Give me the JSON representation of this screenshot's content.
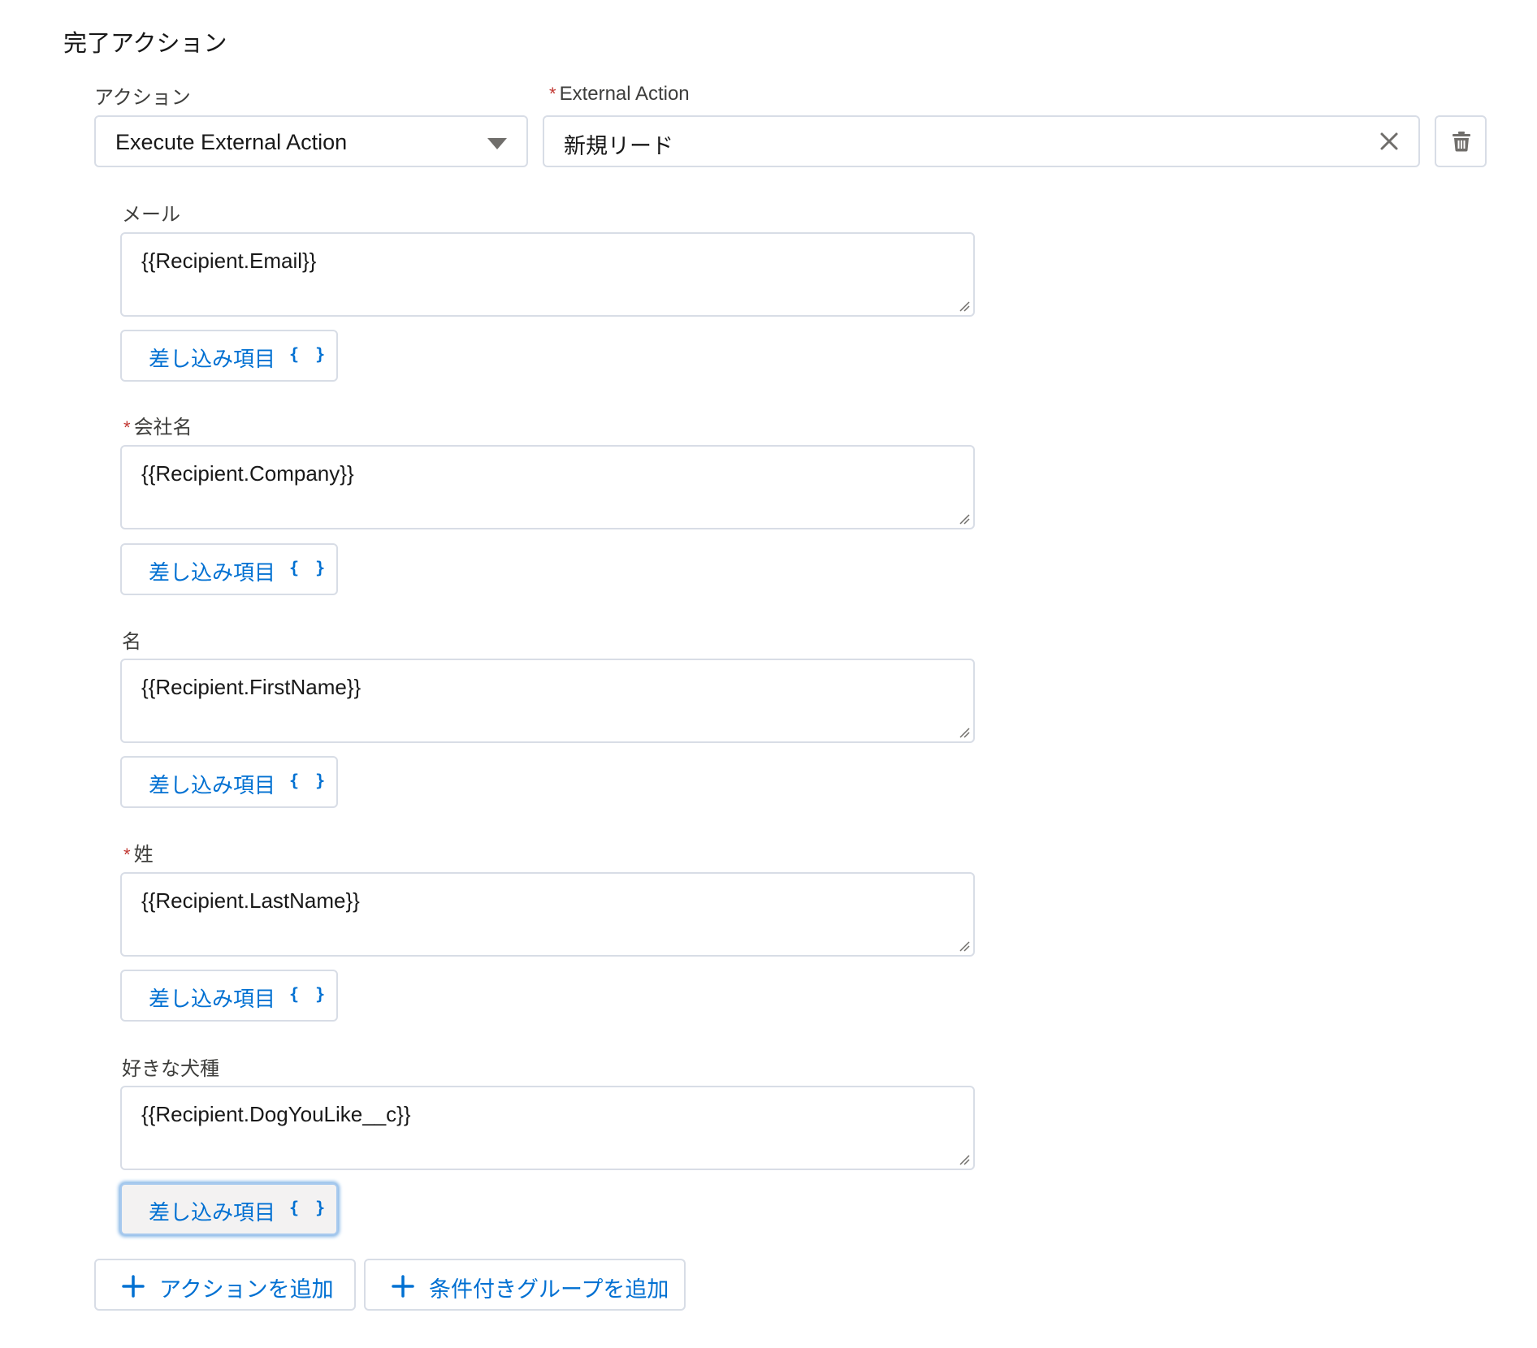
{
  "section": {
    "title": "完了アクション"
  },
  "action": {
    "label": "アクション",
    "selected": "Execute External Action"
  },
  "external_action": {
    "label": "External Action",
    "required_mark": "*",
    "value": "新規リード"
  },
  "fields": [
    {
      "label": "メール",
      "required": false,
      "value": "{{Recipient.Email}}",
      "merge_label": "差し込み項目",
      "merge_icon": "{ }"
    },
    {
      "label": "会社名",
      "required": true,
      "value": "{{Recipient.Company}}",
      "merge_label": "差し込み項目",
      "merge_icon": "{ }"
    },
    {
      "label": "名",
      "required": false,
      "value": "{{Recipient.FirstName}}",
      "merge_label": "差し込み項目",
      "merge_icon": "{ }"
    },
    {
      "label": "姓",
      "required": true,
      "value": "{{Recipient.LastName}}",
      "merge_label": "差し込み項目",
      "merge_icon": "{ }"
    },
    {
      "label": "好きな犬種",
      "required": false,
      "value": "{{Recipient.DogYouLike__c}}",
      "merge_label": "差し込み項目",
      "merge_icon": "{ }"
    }
  ],
  "required_mark": "*",
  "buttons": {
    "add_action": "アクションを追加",
    "add_group": "条件付きグループを追加"
  },
  "colors": {
    "accent": "#0070d2",
    "required": "#c23934",
    "border": "#d8dde6"
  },
  "icons": {
    "select": "chevron-down-icon",
    "clear": "close-icon",
    "delete": "trash-icon",
    "add": "plus-icon"
  }
}
